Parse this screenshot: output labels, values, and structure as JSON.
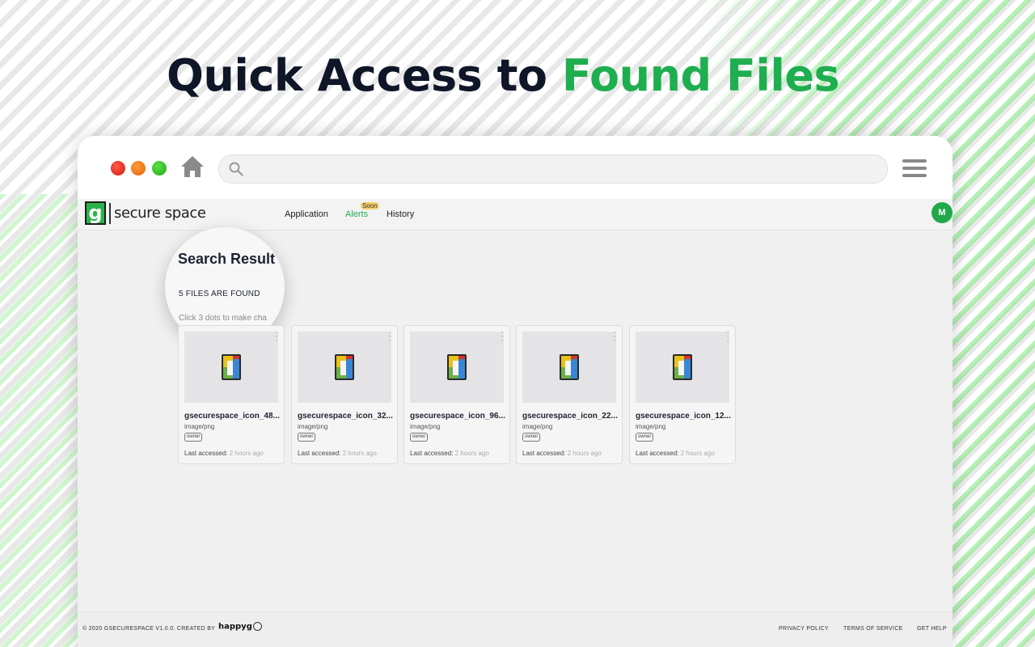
{
  "hero": {
    "title_prefix": "Quick Access to",
    "title_accent": "Found Files"
  },
  "browser": {
    "address_value": "",
    "address_placeholder": ""
  },
  "app": {
    "logo_letter": "g",
    "logo_text": "secure space",
    "nav": {
      "application": "Application",
      "alerts": "Alerts",
      "alerts_badge": "Soon",
      "history": "History"
    },
    "avatar_initial": "M"
  },
  "results": {
    "title": "Search Result",
    "count_text": "5 FILES ARE FOUND",
    "hint": "Click 3 dots to make cha",
    "last_accessed_label": "Last accessed:",
    "files": [
      {
        "name": "gsecurespace_icon_48...",
        "type": "image/png",
        "role": "owner",
        "accessed": "2 hours ago"
      },
      {
        "name": "gsecurespace_icon_32...",
        "type": "image/png",
        "role": "owner",
        "accessed": "2 hours ago"
      },
      {
        "name": "gsecurespace_icon_96...",
        "type": "image/png",
        "role": "owner",
        "accessed": "2 hours ago"
      },
      {
        "name": "gsecurespace_icon_22...",
        "type": "image/png",
        "role": "owner",
        "accessed": "2 hours ago"
      },
      {
        "name": "gsecurespace_icon_12...",
        "type": "image/png",
        "role": "owner",
        "accessed": "2 hours ago"
      }
    ]
  },
  "footer": {
    "copyright": "© 2020 GSECURESPACE V1.0.0. CREATED BY",
    "brand": "happyg",
    "privacy": "PRIVACY POLICY",
    "terms": "TERMS OF SERVICE",
    "help": "GET HELP"
  },
  "colors": {
    "accent": "#1fae4f",
    "hero_dark": "#0e1628",
    "avatar": "#22a84a"
  },
  "icons": [
    "home-icon",
    "search-icon",
    "hamburger-menu-icon",
    "file-icon",
    "more-vertical-icon"
  ]
}
